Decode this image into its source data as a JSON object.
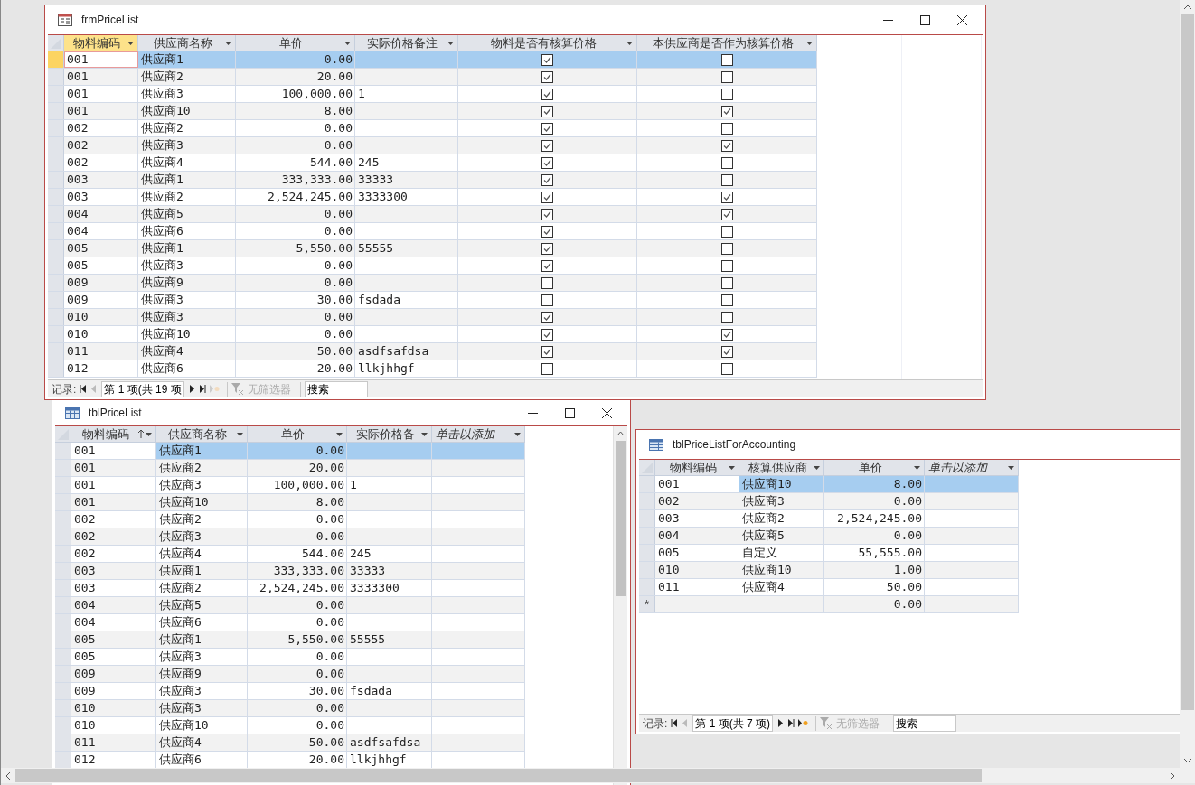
{
  "windows": [
    {
      "kind": "form",
      "title": "frmPriceList",
      "active": true,
      "window_buttons": true,
      "columns": [
        {
          "label": "物料编码",
          "kind": "text"
        },
        {
          "label": "供应商名称",
          "kind": "text"
        },
        {
          "label": "单价",
          "kind": "number"
        },
        {
          "label": "实际价格备注",
          "kind": "text"
        },
        {
          "label": "物料是否有核算价格",
          "kind": "check"
        },
        {
          "label": "本供应商是否作为核算价格",
          "kind": "check"
        }
      ],
      "rows": [
        {
          "selected": true,
          "cells": [
            "001",
            "供应商1",
            "0.00",
            null,
            true,
            false
          ]
        },
        {
          "selected": false,
          "cells": [
            "001",
            "供应商2",
            "20.00",
            null,
            true,
            false
          ]
        },
        {
          "selected": false,
          "cells": [
            "001",
            "供应商3",
            "100,000.00",
            "1",
            true,
            false
          ]
        },
        {
          "selected": false,
          "cells": [
            "001",
            "供应商10",
            "8.00",
            null,
            true,
            true
          ]
        },
        {
          "selected": false,
          "cells": [
            "002",
            "供应商2",
            "0.00",
            null,
            true,
            false
          ]
        },
        {
          "selected": false,
          "cells": [
            "002",
            "供应商3",
            "0.00",
            null,
            true,
            true
          ]
        },
        {
          "selected": false,
          "cells": [
            "002",
            "供应商4",
            "544.00",
            "245",
            true,
            false
          ]
        },
        {
          "selected": false,
          "cells": [
            "003",
            "供应商1",
            "333,333.00",
            "33333",
            true,
            false
          ]
        },
        {
          "selected": false,
          "cells": [
            "003",
            "供应商2",
            "2,524,245.00",
            "3333300",
            true,
            true
          ]
        },
        {
          "selected": false,
          "cells": [
            "004",
            "供应商5",
            "0.00",
            null,
            true,
            true
          ]
        },
        {
          "selected": false,
          "cells": [
            "004",
            "供应商6",
            "0.00",
            null,
            true,
            false
          ]
        },
        {
          "selected": false,
          "cells": [
            "005",
            "供应商1",
            "5,550.00",
            "55555",
            true,
            false
          ]
        },
        {
          "selected": false,
          "cells": [
            "005",
            "供应商3",
            "0.00",
            null,
            true,
            false
          ]
        },
        {
          "selected": false,
          "cells": [
            "009",
            "供应商9",
            "0.00",
            null,
            false,
            false
          ]
        },
        {
          "selected": false,
          "cells": [
            "009",
            "供应商3",
            "30.00",
            "fsdada",
            false,
            false
          ]
        },
        {
          "selected": false,
          "cells": [
            "010",
            "供应商3",
            "0.00",
            null,
            true,
            false
          ]
        },
        {
          "selected": false,
          "cells": [
            "010",
            "供应商10",
            "0.00",
            null,
            true,
            true
          ]
        },
        {
          "selected": false,
          "cells": [
            "011",
            "供应商4",
            "50.00",
            "asdfsafdsa",
            true,
            true
          ]
        },
        {
          "selected": false,
          "cells": [
            "012",
            "供应商6",
            "20.00",
            "llkjhhgf",
            false,
            false
          ]
        }
      ],
      "nav": {
        "label": "记录:",
        "position": "第 1 项(共 19 项",
        "new_record_enabled": false,
        "filter": "无筛选器",
        "search_placeholder": "搜索"
      }
    },
    {
      "kind": "table",
      "title": "tblPriceList",
      "active": false,
      "window_buttons": true,
      "vertical_scrollbar": true,
      "columns": [
        {
          "label": "物料编码",
          "kind": "text",
          "sorted": true
        },
        {
          "label": "供应商名称",
          "kind": "text"
        },
        {
          "label": "单价",
          "kind": "number"
        },
        {
          "label": "实际价格备",
          "kind": "text"
        },
        {
          "label": "单击以添加",
          "kind": "add"
        }
      ],
      "rows": [
        {
          "selected": true,
          "cells": [
            "001",
            "供应商1",
            "0.00",
            null,
            null
          ]
        },
        {
          "selected": false,
          "cells": [
            "001",
            "供应商2",
            "20.00",
            null,
            null
          ]
        },
        {
          "selected": false,
          "cells": [
            "001",
            "供应商3",
            "100,000.00",
            "1",
            null
          ]
        },
        {
          "selected": false,
          "cells": [
            "001",
            "供应商10",
            "8.00",
            null,
            null
          ]
        },
        {
          "selected": false,
          "cells": [
            "002",
            "供应商2",
            "0.00",
            null,
            null
          ]
        },
        {
          "selected": false,
          "cells": [
            "002",
            "供应商3",
            "0.00",
            null,
            null
          ]
        },
        {
          "selected": false,
          "cells": [
            "002",
            "供应商4",
            "544.00",
            "245",
            null
          ]
        },
        {
          "selected": false,
          "cells": [
            "003",
            "供应商1",
            "333,333.00",
            "33333",
            null
          ]
        },
        {
          "selected": false,
          "cells": [
            "003",
            "供应商2",
            "2,524,245.00",
            "3333300",
            null
          ]
        },
        {
          "selected": false,
          "cells": [
            "004",
            "供应商5",
            "0.00",
            null,
            null
          ]
        },
        {
          "selected": false,
          "cells": [
            "004",
            "供应商6",
            "0.00",
            null,
            null
          ]
        },
        {
          "selected": false,
          "cells": [
            "005",
            "供应商1",
            "5,550.00",
            "55555",
            null
          ]
        },
        {
          "selected": false,
          "cells": [
            "005",
            "供应商3",
            "0.00",
            null,
            null
          ]
        },
        {
          "selected": false,
          "cells": [
            "009",
            "供应商9",
            "0.00",
            null,
            null
          ]
        },
        {
          "selected": false,
          "cells": [
            "009",
            "供应商3",
            "30.00",
            "fsdada",
            null
          ]
        },
        {
          "selected": false,
          "cells": [
            "010",
            "供应商3",
            "0.00",
            null,
            null
          ]
        },
        {
          "selected": false,
          "cells": [
            "010",
            "供应商10",
            "0.00",
            null,
            null
          ]
        },
        {
          "selected": false,
          "cells": [
            "011",
            "供应商4",
            "50.00",
            "asdfsafdsa",
            null
          ]
        },
        {
          "selected": false,
          "cells": [
            "012",
            "供应商6",
            "20.00",
            "llkjhhgf",
            null
          ]
        }
      ]
    },
    {
      "kind": "table",
      "title": "tblPriceListForAccounting",
      "active": false,
      "columns": [
        {
          "label": "物料编码",
          "kind": "text"
        },
        {
          "label": "核算供应商",
          "kind": "text"
        },
        {
          "label": "单价",
          "kind": "number"
        },
        {
          "label": "单击以添加",
          "kind": "add"
        }
      ],
      "rows": [
        {
          "selected": true,
          "cells": [
            "001",
            "供应商10",
            "8.00",
            null
          ]
        },
        {
          "selected": false,
          "cells": [
            "002",
            "供应商3",
            "0.00",
            null
          ]
        },
        {
          "selected": false,
          "cells": [
            "003",
            "供应商2",
            "2,524,245.00",
            null
          ]
        },
        {
          "selected": false,
          "cells": [
            "004",
            "供应商5",
            "0.00",
            null
          ]
        },
        {
          "selected": false,
          "cells": [
            "005",
            "自定义",
            "55,555.00",
            null
          ]
        },
        {
          "selected": false,
          "cells": [
            "010",
            "供应商10",
            "1.00",
            null
          ]
        },
        {
          "selected": false,
          "cells": [
            "011",
            "供应商4",
            "50.00",
            null
          ]
        }
      ],
      "new_row": {
        "marker": "*",
        "cells": [
          null,
          null,
          "0.00",
          null
        ]
      },
      "nav": {
        "label": "记录:",
        "position": "第 1 项(共 7 项)",
        "new_record_enabled": true,
        "filter": "无筛选器",
        "search_placeholder": "搜索"
      }
    }
  ]
}
